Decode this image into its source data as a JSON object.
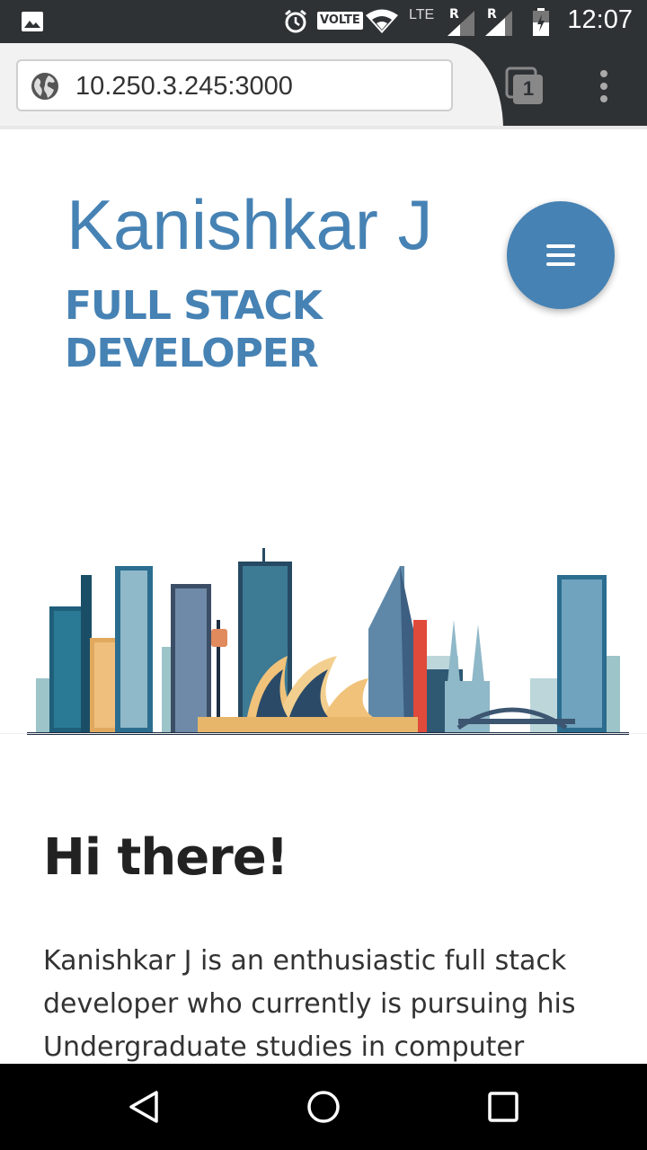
{
  "status_bar": {
    "time": "12:07",
    "volte_label": "VOLTE",
    "lte_label": "LTE",
    "roaming_1": "R",
    "roaming_2": "R",
    "icons": [
      "image-icon",
      "alarm-icon",
      "volte-icon",
      "wifi-icon",
      "signal-icon",
      "signal-icon",
      "battery-icon"
    ]
  },
  "browser": {
    "url": "10.250.3.245:3000",
    "tab_count": "1"
  },
  "header": {
    "name": "Kanishkar J",
    "title": "FULL STACK DEVELOPER",
    "menu_button_icon": "hamburger-icon"
  },
  "main": {
    "greeting": "Hi there!",
    "intro": "Kanishkar J is an enthusiastic full stack developer who currently is pursuing his Undergraduate studies in computer"
  },
  "colors": {
    "accent": "#4682b4",
    "text_dark": "#222222",
    "status_bar": "#2f3235"
  },
  "nav_bar": {
    "icons": [
      "back-icon",
      "home-icon",
      "recents-icon"
    ]
  }
}
